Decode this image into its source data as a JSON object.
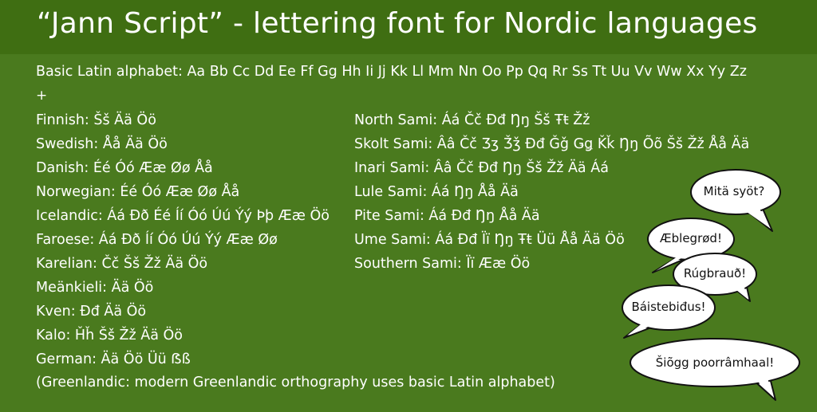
{
  "header": {
    "title": "“Jann Script” - lettering font for Nordic languages"
  },
  "alphabet": {
    "text": "Basic Latin alphabet: Aa Bb Cc Dd Ee Ff Gg Hh Ii Jj Kk Ll Mm Nn Oo Pp Qq Rr Ss Tt Uu Vv Ww Xx Yy Zz",
    "plus": "+"
  },
  "left_languages": [
    "Finnish: Šš Ää Öö",
    "Swedish: Åå Ää Öö",
    "Danish: Éé Óó Ææ Øø Åå",
    "Norwegian: Éé Óó Ææ Øø Åå",
    "Icelandic: Áá Ðð Éé Íí Óó Úú Ýý Þþ Ææ Öö",
    "Faroese: Áá Ðð Íí Óó Úú Ýý Ææ Øø",
    "Karelian:  Čč Šš Žž Ää Öö",
    "Meänkieli: Ää Öö",
    "Kven: Đđ Ää Öö",
    "Kalo: Ȟȟ Šš Žž Ää Öö",
    "German: Ää Öö Üü ẞß"
  ],
  "right_languages": [
    "North Sami: Áá Čč Đđ Ŋŋ Šš Ŧŧ Žž",
    "Skolt Sami: Ââ Čč Ʒʒ Ǯǯ Đđ Ǧǧ Ǥǥ Ǩǩ Ŋŋ Õõ Šš Žž Åå Ää",
    "Inari Sami: Ââ Čč Đđ Ŋŋ Šš Žž Ää Áá",
    "Lule Sami: Áá Ŋŋ Åå Ää",
    "Pite Sami: Áá Đđ Ŋŋ Åå Ää",
    "Ume Sami: Áá Đđ Ïï Ŋŋ Ŧŧ Üü Åå Ää Öö",
    "Southern Sami: Ïï Ææ Öö"
  ],
  "footnote": "(Greenlandic: modern Greenlandic orthography uses basic Latin alphabet)",
  "bubbles": [
    {
      "id": "mita-syot",
      "text": "Mitä syöt?"
    },
    {
      "id": "aeblegrod",
      "text": "Æblegrød!"
    },
    {
      "id": "rugbraud",
      "text": "Rúgbrauð!"
    },
    {
      "id": "baistebidus",
      "text": "Báistebiđus!"
    },
    {
      "id": "siogg",
      "text": "Šiõgg poorrâmhaal!"
    }
  ],
  "colors": {
    "background": "#4a7a1e",
    "header": "#3f6e12",
    "text": "#ffffff",
    "bubble_fill": "#ffffff",
    "bubble_stroke": "#111111"
  }
}
